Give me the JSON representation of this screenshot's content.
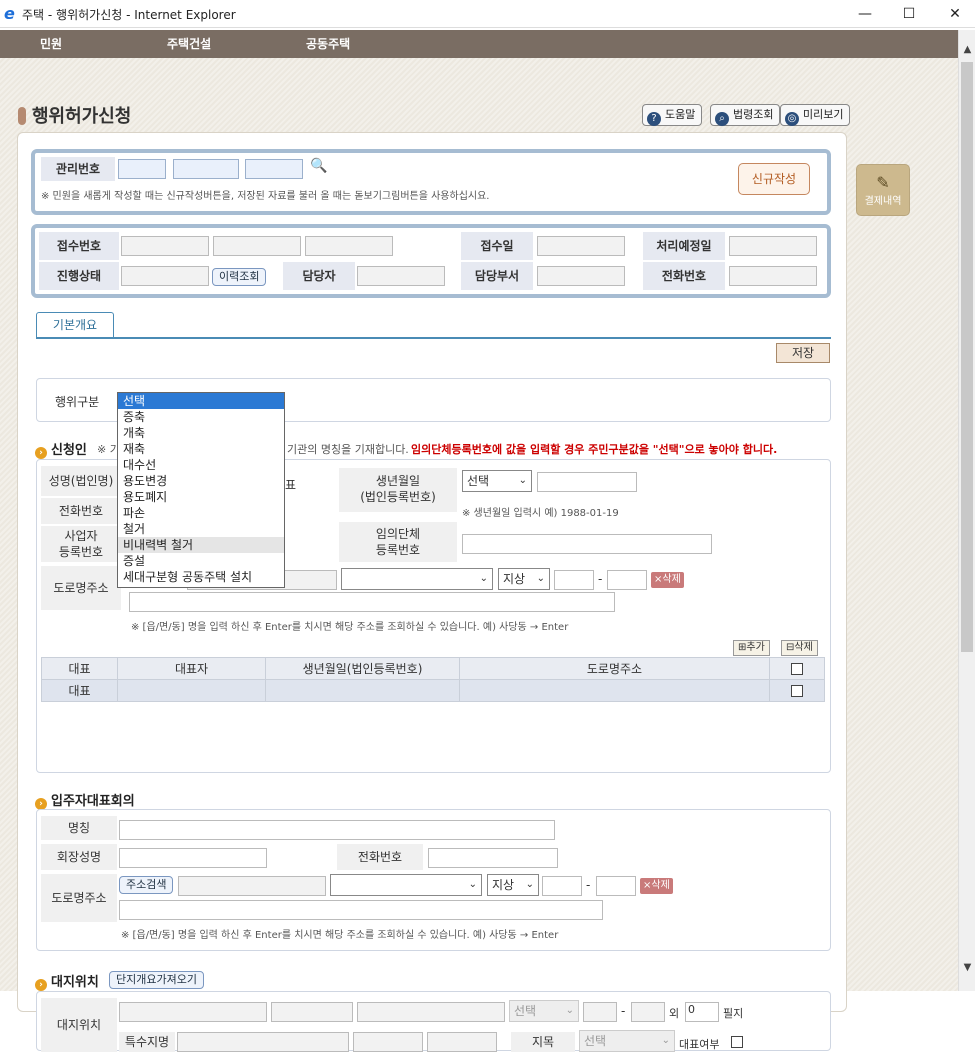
{
  "window": {
    "title": "주택 - 행위허가신청 - Internet Explorer",
    "minimize": "—",
    "maximize": "☐",
    "close": "✕",
    "ie_icon": "e"
  },
  "menu": {
    "items": [
      "민원",
      "주택건설",
      "공동주택"
    ]
  },
  "page": {
    "title": "행위허가신청",
    "help": "도움말",
    "law": "법령조회",
    "preview": "미리보기",
    "approval": "결제내역"
  },
  "mgmt": {
    "label": "관리번호",
    "note": "※ 민원을 새롭게 작성할 때는 신규작성버튼을, 저장된 자료를 불러 올 때는 돋보기그림버튼을 사용하십시요.",
    "new_btn": "신규작성"
  },
  "receipt": {
    "receipt_no": "접수번호",
    "receipt_date": "접수일",
    "due_date": "처리예정일",
    "status": "진행상태",
    "history_btn": "이력조회",
    "manager": "담당자",
    "dept": "담당부서",
    "phone": "전화번호"
  },
  "tabs": {
    "basic": "기본개요"
  },
  "save_btn": "저장",
  "act": {
    "label": "행위구분",
    "selected": "선택",
    "options": [
      "선택",
      "증축",
      "개축",
      "재축",
      "대수선",
      "용도변경",
      "용도폐지",
      "파손",
      "철거",
      "비내력벽 철거",
      "증설",
      "세대구분형 공동주택 설치"
    ]
  },
  "applicant": {
    "title": "신청인",
    "note_a": "※ 기",
    "note_b": "기관의 명칭을 기재합니다.",
    "note_red": "임의단체등록번호에 값을 입력할 경우 주민구분값을 \"선택\"으로 놓아야 합니다.",
    "name": "성명(법인명)",
    "rep": "표",
    "birth": "생년월일",
    "birth2": "(법인등록번호)",
    "birth_select": "선택",
    "birth_note": "※ 생년월일 입력시 예) 1988-01-19",
    "phone": "전화번호",
    "biz": "사업자",
    "biz2": "등록번호",
    "group": "임의단체",
    "group2": "등록번호",
    "road": "도로명주소",
    "ground": "지상",
    "delete": "×삭제",
    "road_note": "※ [읍/면/동] 명을 입력 하신 후 Enter를 치시면 해당 주소를 조회하실 수 있습니다. 예) 사당동 → Enter",
    "add": "⊞추가",
    "del": "⊟삭제",
    "table": {
      "headers": [
        "대표",
        "대표자",
        "생년월일(법인등록번호)",
        "도로명주소"
      ],
      "row": [
        "대표"
      ]
    }
  },
  "resident": {
    "title": "입주자대표회의",
    "name": "명칭",
    "chair": "회장성명",
    "phone": "전화번호",
    "road": "도로명주소",
    "search": "주소검색",
    "ground": "지상",
    "delete": "×삭제",
    "note": "※ [읍/면/동] 명을 입력 하신 후 Enter를 치시면 해당 주소를 조회하실 수 있습니다. 예) 사당동 → Enter"
  },
  "site": {
    "title": "대지위치",
    "fetch_btn": "단지개요가져오기",
    "label": "대지위치",
    "select": "선택",
    "oe": "외",
    "count": "0",
    "lots": "필지",
    "special": "특수지명",
    "jimok": "지목",
    "jimok_select": "선택",
    "rep": "대표여부"
  }
}
